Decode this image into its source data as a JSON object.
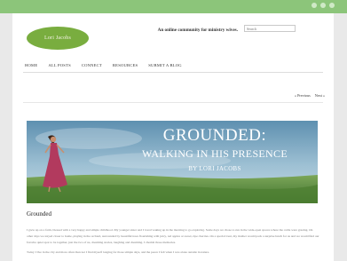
{
  "header": {
    "logo_text": "Lori Jacobs",
    "tagline": "An online community for ministry wives.",
    "search_placeholder": "Search"
  },
  "nav": {
    "items": [
      "HOME",
      "ALL POSTS",
      "CONNECT",
      "RESOURCES",
      "SUBMIT A BLOG"
    ]
  },
  "pager": {
    "prev": "« Previous",
    "next": "Next »"
  },
  "banner": {
    "title": "GROUNDED:",
    "subtitle": "WALKING IN HIS PRESENCE",
    "byline": "BY LORI JACOBS"
  },
  "post": {
    "title": "Grounded",
    "paragraphs": [
      "I grew up on a farm, blessed with a very happy and simple childhood. My younger sister and I loved waking up in the morning to go exploring. Some days we chose to run in the wide-open spaces where the cattle were grazing. On other days we stayed closer to home, playing in the orchard, surrounded by beautiful trees flourishing with juicy, red apples or sweet, ripe cherries. On a special treat, my mother would pack a surprise lunch for us and we would find our favorite quiet spot to be together, just the two of us, dreaming stories, laughing and dreaming. I cherish those memories.",
      "Today I live in the city and more often than not I find myself longing for those simple days, and the peace I felt when I was alone outside in nature."
    ]
  },
  "colors": {
    "topbar": "#8cc57a",
    "logo_bg": "#79ad3f"
  }
}
